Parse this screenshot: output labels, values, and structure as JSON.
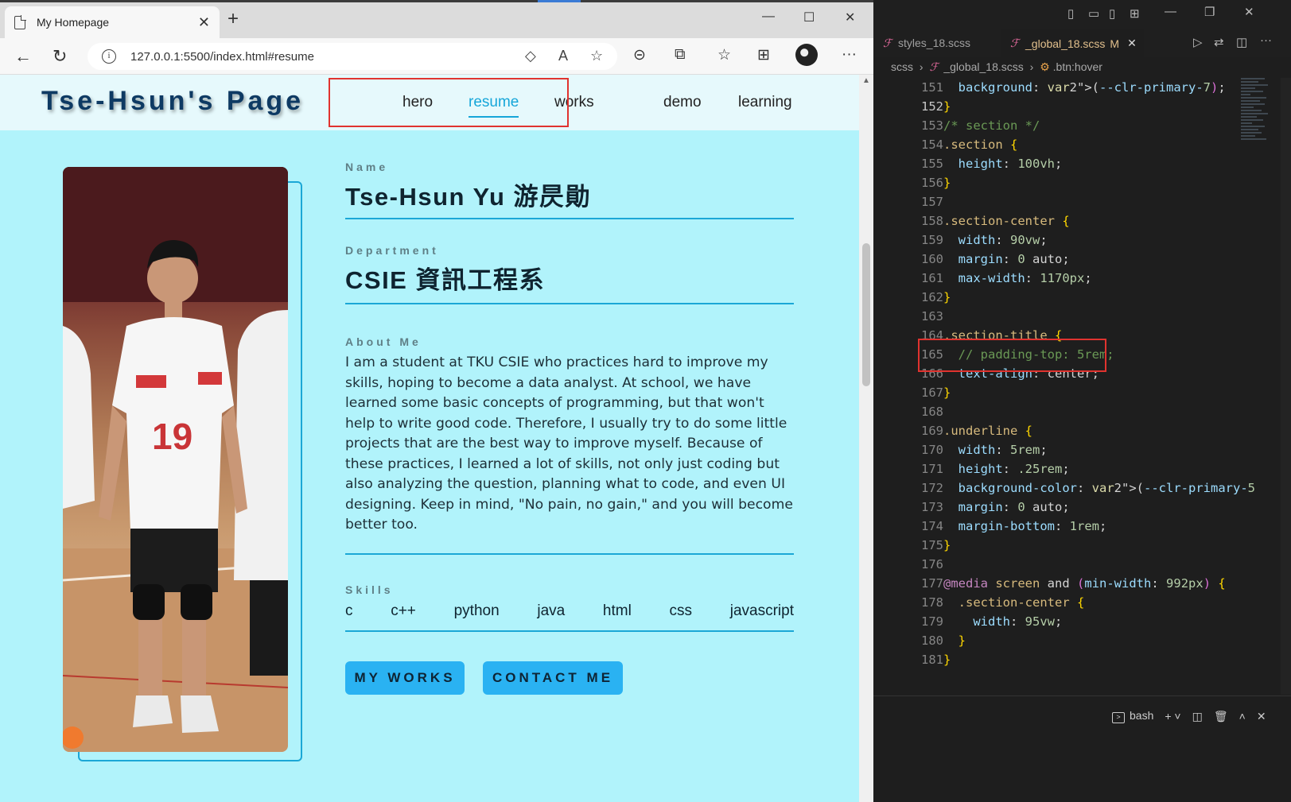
{
  "browser": {
    "tab_title": "My Homepage",
    "url": "127.0.0.1:5500/index.html#resume"
  },
  "site": {
    "logo": "Tse-Hsun's Page",
    "nav": [
      "hero",
      "resume",
      "works",
      "demo",
      "learning"
    ],
    "active_nav": "resume",
    "name_label": "Name",
    "name": "Tse-Hsun Yu 游昃勛",
    "dept_label": "Department",
    "dept": "CSIE 資訊工程系",
    "about_label": "About Me",
    "about": "I am a student at TKU CSIE who practices hard to improve my skills, hoping to become a data analyst. At school, we have learned some basic concepts of programming, but that won't help to write good code. Therefore, I usually try to do some little projects that are the best way to improve myself. Because of these practices, I learned a lot of skills, not only just coding but also analyzing the question, planning what to code, and even UI designing. Keep in mind, \"No pain, no gain,\" and you will become better too.",
    "skills_label": "Skills",
    "skills": [
      "c",
      "c++",
      "python",
      "java",
      "html",
      "css",
      "javascript"
    ],
    "btn_works": "MY WORKS",
    "btn_contact": "CONTACT ME"
  },
  "vscode": {
    "tab1": "styles_18.scss",
    "tab2": "_global_18.scss",
    "tab2_status": "M",
    "crumb1": "scss",
    "crumb2": "_global_18.scss",
    "crumb3": ".btn:hover",
    "terminal": "bash"
  },
  "code_lines": [
    {
      "n": "151",
      "t": "  background: var(--clr-primary-7);"
    },
    {
      "n": "152",
      "t": "}"
    },
    {
      "n": "153",
      "t": "/* section */"
    },
    {
      "n": "154",
      "t": ".section {"
    },
    {
      "n": "155",
      "t": "  height: 100vh;"
    },
    {
      "n": "156",
      "t": "}"
    },
    {
      "n": "157",
      "t": ""
    },
    {
      "n": "158",
      "t": ".section-center {"
    },
    {
      "n": "159",
      "t": "  width: 90vw;"
    },
    {
      "n": "160",
      "t": "  margin: 0 auto;"
    },
    {
      "n": "161",
      "t": "  max-width: 1170px;"
    },
    {
      "n": "162",
      "t": "}"
    },
    {
      "n": "163",
      "t": ""
    },
    {
      "n": "164",
      "t": ".section-title {"
    },
    {
      "n": "165",
      "t": "  // padding-top: 5rem;"
    },
    {
      "n": "166",
      "t": "  text-align: center;"
    },
    {
      "n": "167",
      "t": "}"
    },
    {
      "n": "168",
      "t": ""
    },
    {
      "n": "169",
      "t": ".underline {"
    },
    {
      "n": "170",
      "t": "  width: 5rem;"
    },
    {
      "n": "171",
      "t": "  height: .25rem;"
    },
    {
      "n": "172",
      "t": "  background-color: var(--clr-primary-5"
    },
    {
      "n": "173",
      "t": "  margin: 0 auto;"
    },
    {
      "n": "174",
      "t": "  margin-bottom: 1rem;"
    },
    {
      "n": "175",
      "t": "}"
    },
    {
      "n": "176",
      "t": ""
    },
    {
      "n": "177",
      "t": "@media screen and (min-width: 992px) {"
    },
    {
      "n": "178",
      "t": "  .section-center {"
    },
    {
      "n": "179",
      "t": "    width: 95vw;"
    },
    {
      "n": "180",
      "t": "  }"
    },
    {
      "n": "181",
      "t": "}"
    }
  ]
}
